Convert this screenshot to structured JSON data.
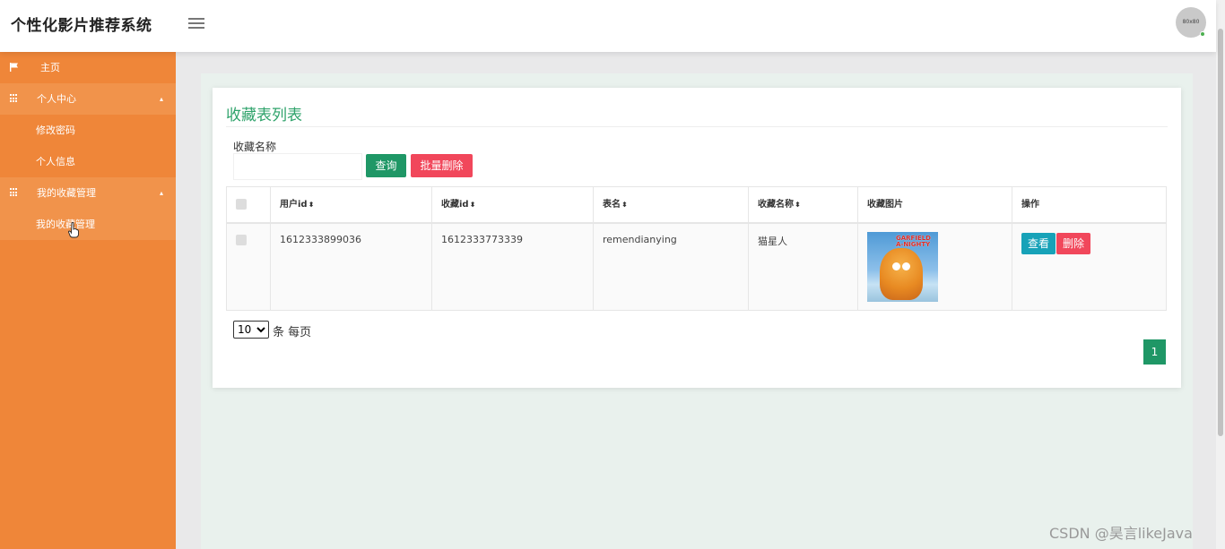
{
  "header": {
    "brand": "个性化影片推荐系统",
    "avatar_text": "80x80"
  },
  "sidebar": {
    "items": [
      {
        "label": "主页",
        "icon": "flag-icon"
      },
      {
        "label": "个人中心",
        "icon": "grid-icon",
        "expanded": true
      },
      {
        "label": "修改密码"
      },
      {
        "label": "个人信息"
      },
      {
        "label": "我的收藏管理",
        "icon": "grid-icon",
        "expanded": true
      },
      {
        "label": "我的收藏管理",
        "active": true
      }
    ]
  },
  "main": {
    "title": "收藏表列表",
    "search": {
      "label": "收藏名称",
      "value": "",
      "query_button": "查询",
      "batch_delete_button": "批量删除"
    },
    "table": {
      "columns": [
        "用户id",
        "收藏id",
        "表名",
        "收藏名称",
        "收藏图片",
        "操作"
      ],
      "rows": [
        {
          "user_id": "1612333899036",
          "fav_id": "1612333773339",
          "table_name": "remendianying",
          "fav_name": "猫星人",
          "image_text": "GARFIELD A-NIGHTY",
          "view_button": "查看",
          "delete_button": "删除"
        }
      ]
    },
    "pagination": {
      "page_size": "10",
      "page_size_options": [
        "10"
      ],
      "page_size_suffix": "条 每页",
      "current_page": "1"
    }
  },
  "watermark": "CSDN @昊言likeJava",
  "colors": {
    "sidebar": "#ef8639",
    "sidebar_active": "#f1934b",
    "primary_green": "#1f9766",
    "title_green": "#2fa36b",
    "danger": "#f1475b",
    "info": "#17a2b8"
  }
}
